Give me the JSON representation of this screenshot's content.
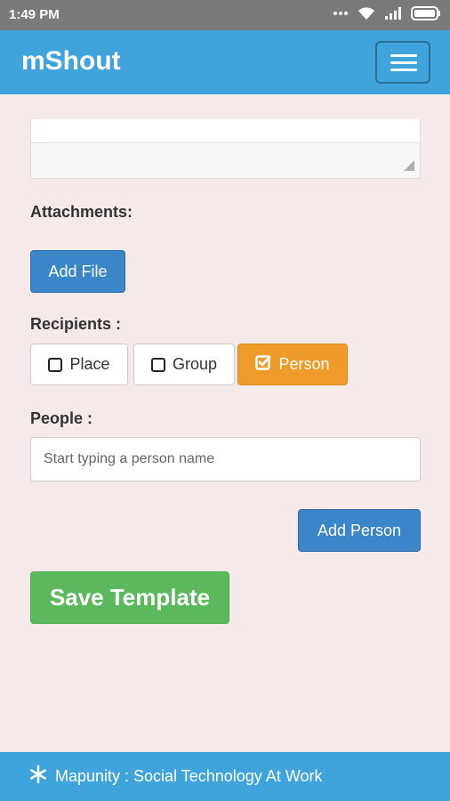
{
  "status_bar": {
    "time": "1:49 PM",
    "icons": [
      "dots-icon",
      "wifi-icon",
      "signal-icon",
      "battery-icon"
    ]
  },
  "app_bar": {
    "title": "mShout",
    "menu_icon": "hamburger-menu-icon"
  },
  "message_field": {
    "value": ""
  },
  "attachments": {
    "label": "Attachments:",
    "add_file_button": "Add File"
  },
  "recipients": {
    "label": "Recipients :",
    "options": [
      {
        "label": "Place",
        "checked": false
      },
      {
        "label": "Group",
        "checked": false
      },
      {
        "label": "Person",
        "checked": true
      }
    ]
  },
  "people": {
    "label": "People :",
    "placeholder": "Start typing a person name",
    "add_person_button": "Add Person"
  },
  "actions": {
    "save_template_button": "Save Template"
  },
  "footer": {
    "icon": "snowflake-icon",
    "text": "Mapunity : Social Technology At Work"
  },
  "colors": {
    "app_bar": "#3fa4db",
    "background": "#f5eae9",
    "primary_button": "#3a86c8",
    "active_toggle": "#ef9b2a",
    "save_button": "#5cb85c"
  }
}
